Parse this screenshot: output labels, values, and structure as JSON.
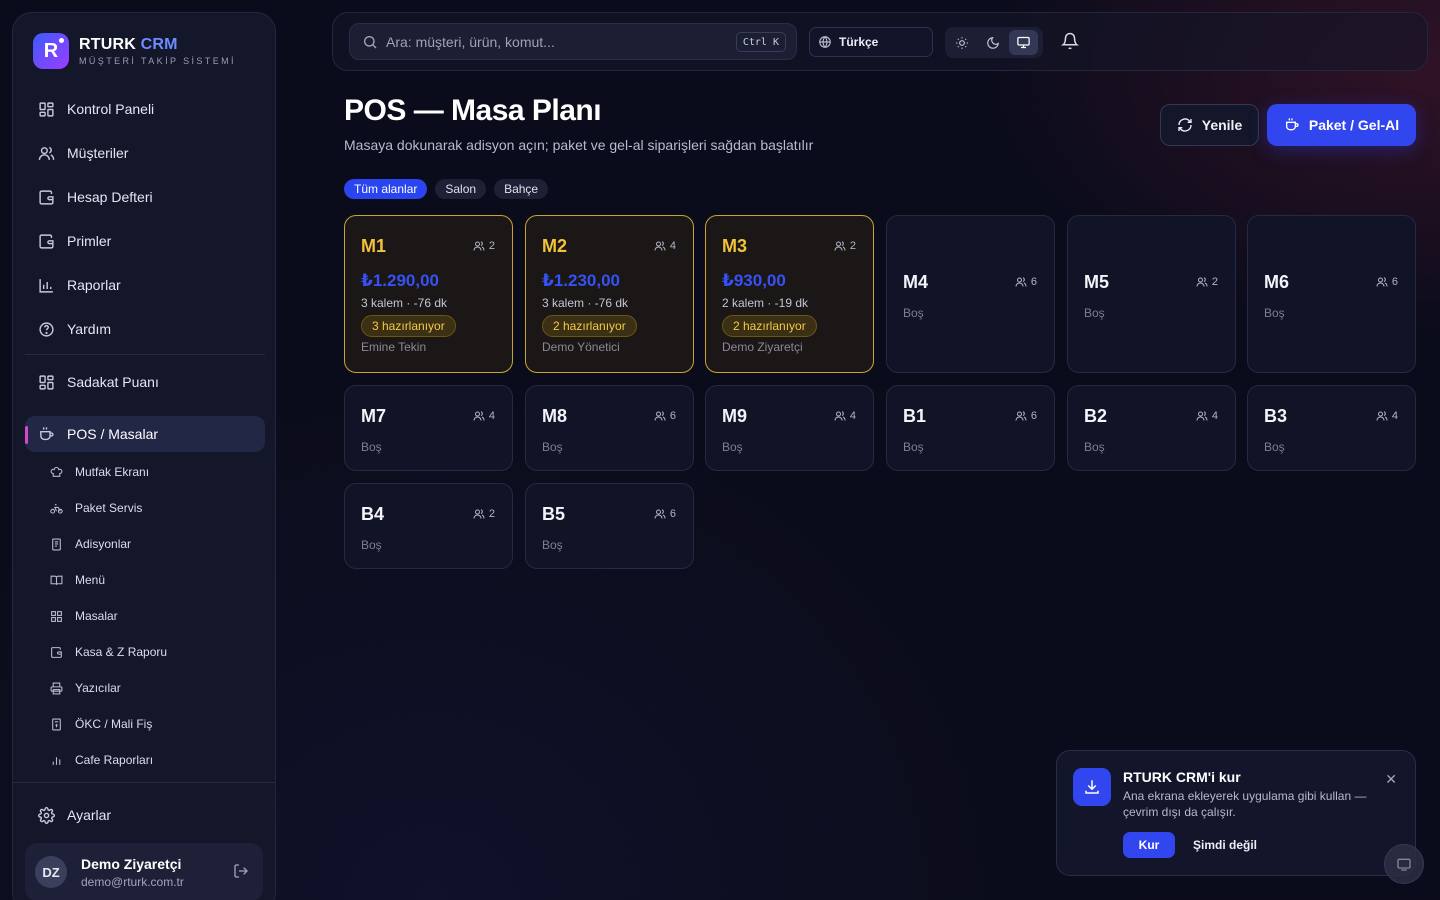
{
  "brand": {
    "name_a": "RTURK",
    "name_b": "CRM",
    "subtitle": "MÜŞTERİ TAKİP SİSTEMİ",
    "logo_letter": "R"
  },
  "sidebar": {
    "items": [
      {
        "label": "Kontrol Paneli",
        "icon": "dashboard-icon"
      },
      {
        "label": "Müşteriler",
        "icon": "users-icon"
      },
      {
        "label": "Hesap Defteri",
        "icon": "wallet-icon"
      },
      {
        "label": "Primler",
        "icon": "wallet-icon"
      },
      {
        "label": "Raporlar",
        "icon": "chart-icon"
      },
      {
        "label": "Yardım",
        "icon": "help-icon"
      }
    ],
    "loyalty": {
      "label": "Sadakat Puanı",
      "icon": "grid-icon"
    },
    "pos": {
      "label": "POS / Masalar",
      "icon": "cup-icon"
    },
    "subitems": [
      {
        "label": "Mutfak Ekranı",
        "icon": "chef-hat-icon"
      },
      {
        "label": "Paket Servis",
        "icon": "bike-icon"
      },
      {
        "label": "Adisyonlar",
        "icon": "receipt-icon"
      },
      {
        "label": "Menü",
        "icon": "book-icon"
      },
      {
        "label": "Masalar",
        "icon": "grid-icon"
      },
      {
        "label": "Kasa & Z Raporu",
        "icon": "wallet-icon"
      },
      {
        "label": "Yazıcılar",
        "icon": "printer-icon"
      },
      {
        "label": "ÖKC / Mali Fiş",
        "icon": "receipt-icon"
      },
      {
        "label": "Cafe Raporları",
        "icon": "bar-chart-icon"
      }
    ],
    "settings": {
      "label": "Ayarlar",
      "icon": "gear-icon"
    },
    "user": {
      "initials": "DZ",
      "name": "Demo Ziyaretçi",
      "email": "demo@rturk.com.tr"
    }
  },
  "topbar": {
    "search_placeholder": "Ara: müşteri, ürün, komut...",
    "shortcut": "Ctrl K",
    "language": "Türkçe"
  },
  "page": {
    "title": "POS — Masa Planı",
    "subtitle": "Masaya dokunarak adisyon açın; paket ve gel-al siparişleri sağdan başlatılır",
    "refresh_label": "Yenile",
    "package_label": "Paket / Gel-Al",
    "filters": [
      "Tüm alanlar",
      "Salon",
      "Bahçe"
    ],
    "active_filter": "Tüm alanlar"
  },
  "tables": [
    {
      "name": "M1",
      "seats": "2",
      "busy": true,
      "amount": "₺1.290,00",
      "meta": "3 kalem · -76 dk",
      "badge": "3 hazırlanıyor",
      "waiter": "Emine Tekin"
    },
    {
      "name": "M2",
      "seats": "4",
      "busy": true,
      "amount": "₺1.230,00",
      "meta": "3 kalem · -76 dk",
      "badge": "2 hazırlanıyor",
      "waiter": "Demo Yönetici"
    },
    {
      "name": "M3",
      "seats": "2",
      "busy": true,
      "amount": "₺930,00",
      "meta": "2 kalem · -19 dk",
      "badge": "2 hazırlanıyor",
      "waiter": "Demo Ziyaretçi"
    },
    {
      "name": "M4",
      "seats": "6",
      "busy": false,
      "status": "Boş"
    },
    {
      "name": "M5",
      "seats": "2",
      "busy": false,
      "status": "Boş"
    },
    {
      "name": "M6",
      "seats": "6",
      "busy": false,
      "status": "Boş"
    },
    {
      "name": "M7",
      "seats": "4",
      "busy": false,
      "status": "Boş"
    },
    {
      "name": "M8",
      "seats": "6",
      "busy": false,
      "status": "Boş"
    },
    {
      "name": "M9",
      "seats": "4",
      "busy": false,
      "status": "Boş"
    },
    {
      "name": "B1",
      "seats": "6",
      "busy": false,
      "status": "Boş"
    },
    {
      "name": "B2",
      "seats": "4",
      "busy": false,
      "status": "Boş"
    },
    {
      "name": "B3",
      "seats": "4",
      "busy": false,
      "status": "Boş"
    },
    {
      "name": "B4",
      "seats": "2",
      "busy": false,
      "status": "Boş"
    },
    {
      "name": "B5",
      "seats": "6",
      "busy": false,
      "status": "Boş"
    }
  ],
  "install_prompt": {
    "title": "RTURK CRM'i kur",
    "text": "Ana ekrana ekleyerek uygulama gibi kullan — çevrim dışı da çalışır.",
    "install_label": "Kur",
    "later_label": "Şimdi değil"
  },
  "colors": {
    "accent": "#3146ee",
    "busy": "#f2c23a",
    "active_marker": "#d24ac8"
  }
}
